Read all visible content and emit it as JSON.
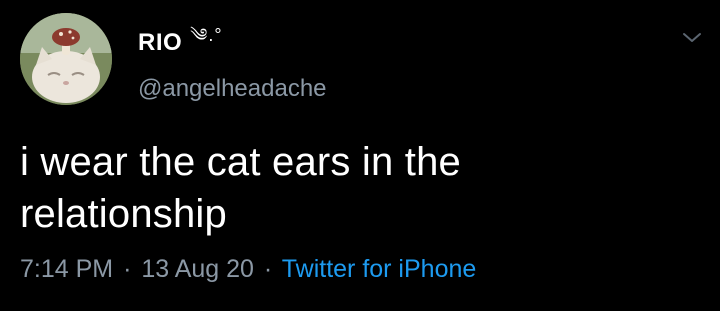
{
  "user": {
    "display_name": "RIO",
    "name_emoji": "༄.°",
    "handle": "@angelheadache"
  },
  "tweet": {
    "text_line1": "i wear the cat ears in the",
    "text_line2": "relationship",
    "time": "7:14 PM",
    "separator": "·",
    "date": "13 Aug 20",
    "source": "Twitter for iPhone"
  },
  "icons": {
    "menu": "chevron-down-icon",
    "avatar": "cat-with-mushroom-hat"
  },
  "colors": {
    "background": "#000000",
    "text": "#ffffff",
    "secondary": "#8b98a5",
    "link": "#1d9bf0"
  }
}
